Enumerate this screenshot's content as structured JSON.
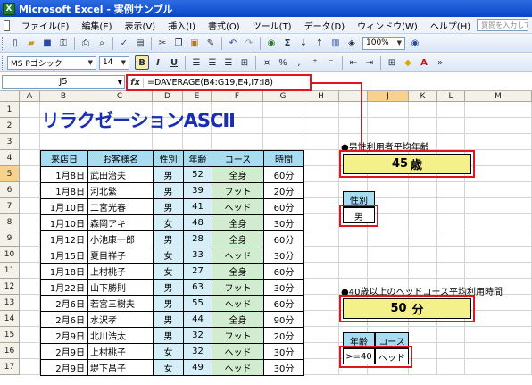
{
  "window": {
    "title": "Microsoft Excel - 実例サンプル",
    "app_icon_text": "X"
  },
  "menu": {
    "items": [
      "ファイル(F)",
      "編集(E)",
      "表示(V)",
      "挿入(I)",
      "書式(O)",
      "ツール(T)",
      "データ(D)",
      "ウィンドウ(W)",
      "ヘルプ(H)"
    ],
    "help_placeholder": "質問を入力してください"
  },
  "toolbar": {
    "zoom": "100%",
    "font_name": "MS Pゴシック",
    "font_size": "14",
    "bold": "B",
    "italic": "I",
    "underline": "U",
    "percent": "%",
    "comma": ",",
    "sigma": "Σ"
  },
  "formula_bar": {
    "name_box": "J5",
    "fx": "fx",
    "formula": "=DAVERAGE(B4:G19,E4,I7:I8)"
  },
  "columns": [
    "A",
    "B",
    "C",
    "D",
    "E",
    "F",
    "G",
    "H",
    "I",
    "J",
    "K",
    "L",
    "M"
  ],
  "rows": [
    "1",
    "2",
    "3",
    "4",
    "5",
    "6",
    "7",
    "8",
    "9",
    "10",
    "11",
    "12",
    "13",
    "14",
    "15",
    "16",
    "17"
  ],
  "selection": {
    "col": "J",
    "row": "5"
  },
  "sheet": {
    "title": "リラクゼーションASCII",
    "table_headers": [
      "来店日",
      "お客様名",
      "性別",
      "年齢",
      "コース",
      "時間"
    ],
    "table_rows": [
      [
        "1月8日",
        "武田治夫",
        "男",
        "52",
        "全身",
        "60分"
      ],
      [
        "1月8日",
        "河北繁",
        "男",
        "39",
        "フット",
        "20分"
      ],
      [
        "1月10日",
        "二宮光春",
        "男",
        "41",
        "ヘッド",
        "60分"
      ],
      [
        "1月10日",
        "森岡アキ",
        "女",
        "48",
        "全身",
        "30分"
      ],
      [
        "1月12日",
        "小池康一郎",
        "男",
        "28",
        "全身",
        "60分"
      ],
      [
        "1月15日",
        "夏目祥子",
        "女",
        "33",
        "ヘッド",
        "30分"
      ],
      [
        "1月18日",
        "上村桃子",
        "女",
        "27",
        "全身",
        "60分"
      ],
      [
        "1月22日",
        "山下勝則",
        "男",
        "63",
        "フット",
        "30分"
      ],
      [
        "2月6日",
        "若宮三樹夫",
        "男",
        "55",
        "ヘッド",
        "60分"
      ],
      [
        "2月6日",
        "水沢孝",
        "男",
        "44",
        "全身",
        "90分"
      ],
      [
        "2月9日",
        "北川浩太",
        "男",
        "32",
        "フット",
        "20分"
      ],
      [
        "2月9日",
        "上村桃子",
        "女",
        "32",
        "ヘッド",
        "30分"
      ],
      [
        "2月9日",
        "堤下昌子",
        "女",
        "49",
        "ヘッド",
        "30分"
      ]
    ],
    "label1": "●男性利用者平均年齢",
    "result1": {
      "value": "45",
      "unit": "歳"
    },
    "criteria1": {
      "header": "性別",
      "value": "男"
    },
    "label2": "●40歳以上のヘッドコース平均利用時間",
    "result2": {
      "value": "50",
      "unit": "分"
    },
    "criteria2": {
      "headers": [
        "年齢",
        "コース"
      ],
      "values": [
        ">=40",
        "ヘッド"
      ]
    }
  },
  "colors": {
    "accent_red": "#e0151f",
    "title_blue": "#1a2fb0",
    "header_blue": "#a8dcf0",
    "result_yellow": "#f4f08a",
    "pale_blue": "#d6eef8",
    "pale_green": "#d2ecd0"
  }
}
